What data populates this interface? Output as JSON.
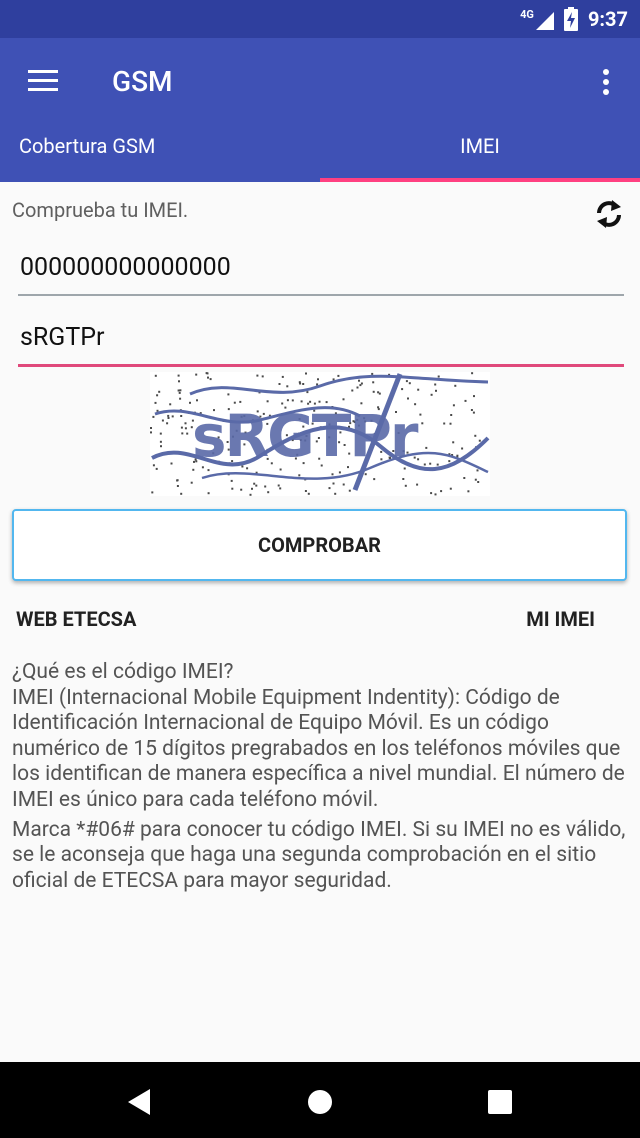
{
  "status_bar": {
    "network_label": "4G",
    "time": "9:37",
    "icons": [
      "signal-icon",
      "battery-charging-icon"
    ]
  },
  "app_bar": {
    "title": "GSM",
    "icons": [
      "menu-icon",
      "more-vert-icon"
    ],
    "tabs": [
      {
        "label": "Cobertura GSM",
        "selected": false
      },
      {
        "label": "IMEI",
        "selected": true
      }
    ]
  },
  "content": {
    "hint_text": "Comprueba tu IMEI.",
    "refresh_icon": "refresh-icon",
    "imei_field": {
      "value": "000000000000000"
    },
    "captcha_field": {
      "value": "sRGTPr"
    },
    "captcha_image_text": "sRGTPr",
    "check_button_label": "COMPROBAR",
    "link_web": "WEB ETECSA",
    "link_my_imei": "MI IMEI",
    "description": {
      "question": "¿Qué es el código IMEI?",
      "paragraph1": "IMEI (Internacional Mobile Equipment Indentity): Código de Identificación Internacional de Equipo Móvil. Es un código numérico de 15 dígitos pregrabados en los teléfonos móviles que los identifican de manera específica a nivel mundial. El número de IMEI es único para cada teléfono móvil.",
      "paragraph2": "Marca *#06# para conocer tu código IMEI. Si su IMEI no es válido, se le aconseja que haga una segunda comprobación en el sitio oficial de ETECSA para mayor seguridad."
    }
  },
  "nav_bar": {
    "icons": [
      "back-icon",
      "home-icon",
      "recents-icon"
    ]
  },
  "colors": {
    "status_bar": "#2f3f9e",
    "app_bar": "#3f51b5",
    "tab_indicator": "#ff4081",
    "captcha_input_underline": "#e0497b",
    "button_border": "#52b7ef",
    "captcha_text": "#5a6aa8"
  }
}
